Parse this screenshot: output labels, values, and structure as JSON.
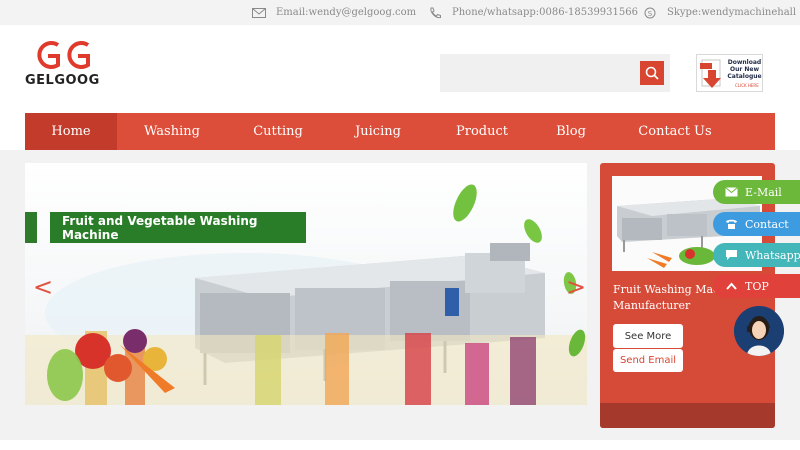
{
  "topbar": {
    "email": "Email:wendy@gelgoog.com",
    "phone": "Phone/whatsapp:0086-18539931566",
    "skype": "Skype:wendymachinehall"
  },
  "header": {
    "logo_text": "GELGOOG",
    "search_placeholder": "",
    "search_icon": "search-icon",
    "catalogue": {
      "line1": "Download",
      "line2": "Our New",
      "line3": "Catalogue",
      "click": "CLICK HERE"
    }
  },
  "nav": {
    "items": [
      {
        "label": "Home",
        "active": true
      },
      {
        "label": "Washing",
        "active": false
      },
      {
        "label": "Cutting",
        "active": false
      },
      {
        "label": "Juicing",
        "active": false
      },
      {
        "label": "Product",
        "active": false
      },
      {
        "label": "Blog",
        "active": false
      },
      {
        "label": "Contact Us",
        "active": false
      }
    ]
  },
  "banner": {
    "title": "Fruit and Vegetable Washing Machine",
    "prev": "<",
    "next": ">"
  },
  "side_panel": {
    "text": "Fruit Washing Machine Manufacturer",
    "see_more": "See More",
    "send_email": "Send Email"
  },
  "floating": {
    "email": "E-Mail",
    "contact": "Contact",
    "whatsapp": "Whatsapp",
    "top": "TOP"
  },
  "colors": {
    "brand_red": "#dc4e3a",
    "nav_active": "#c33b2a",
    "banner_green": "#2a7d28",
    "email_green": "#6cb83a",
    "contact_blue": "#3d9be0",
    "whatsapp_teal": "#43b6b9"
  }
}
